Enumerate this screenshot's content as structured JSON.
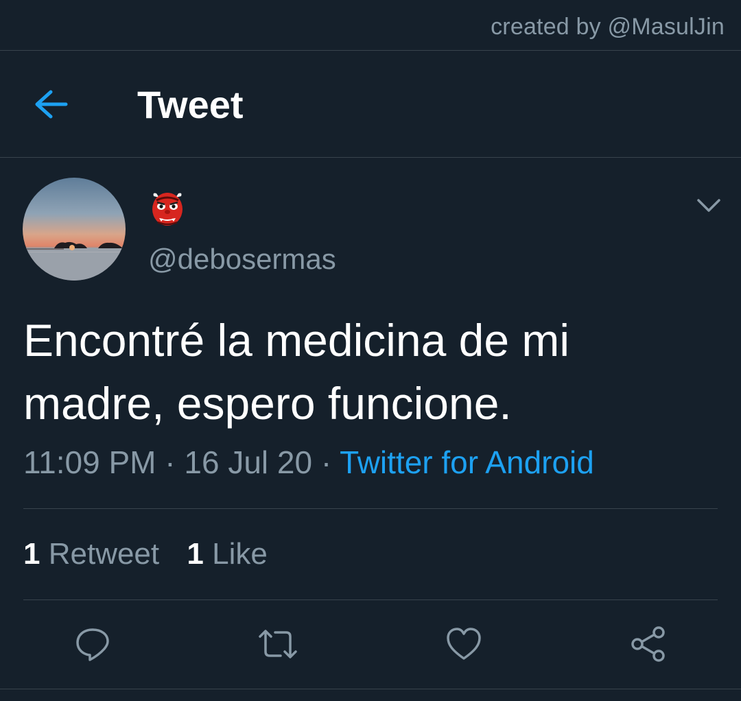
{
  "watermark": "created by @MasulJin",
  "header": {
    "title": "Tweet",
    "back_icon": "arrow-left-icon"
  },
  "tweet": {
    "display_name_icon": "japanese-goblin-emoji",
    "handle": "@debosermas",
    "text": "Encontré la medicina de mi madre, espero funcione.",
    "time": "11:09 PM",
    "separator": "·",
    "date": "16 Jul 20",
    "source": "Twitter for Android",
    "retweet_count": "1",
    "retweet_label": "Retweet",
    "like_count": "1",
    "like_label": "Like"
  },
  "actions": [
    {
      "name": "reply",
      "icon": "speech-bubble-icon"
    },
    {
      "name": "retweet",
      "icon": "retweet-arrows-icon"
    },
    {
      "name": "like",
      "icon": "heart-icon"
    },
    {
      "name": "share",
      "icon": "share-nodes-icon"
    }
  ],
  "colors": {
    "background": "#15202b",
    "border": "#38444d",
    "text_primary": "#ffffff",
    "text_secondary": "#8899a6",
    "accent": "#1da1f2"
  }
}
